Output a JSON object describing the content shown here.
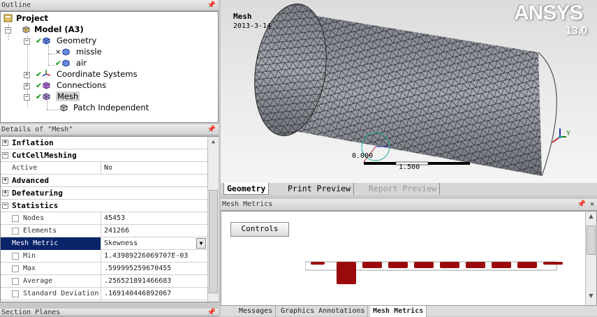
{
  "outline": {
    "title": "Outline",
    "tree": [
      {
        "label": "Project"
      },
      {
        "label": "Model (A3)"
      },
      {
        "label": "Geometry"
      },
      {
        "label": "missle"
      },
      {
        "label": "air"
      },
      {
        "label": "Coordinate Systems"
      },
      {
        "label": "Connections"
      },
      {
        "label": "Mesh"
      },
      {
        "label": "Patch Independent"
      }
    ]
  },
  "details": {
    "title": "Details of \"Mesh\"",
    "groups": {
      "inflation": "Inflation",
      "cutcell": "CutCellMeshing",
      "advanced": "Advanced",
      "defeaturing": "Defeaturing",
      "statistics": "Statistics"
    },
    "props": {
      "active": {
        "key": "Active",
        "value": "No"
      },
      "nodes": {
        "key": "Nodes",
        "value": "45453"
      },
      "elements": {
        "key": "Elements",
        "value": "241266"
      },
      "metric": {
        "key": "Mesh Metric",
        "value": "Skewness"
      },
      "min": {
        "key": "Min",
        "value": "1.43989226069707E-03"
      },
      "max": {
        "key": "Max",
        "value": ".599995259670455"
      },
      "average": {
        "key": "Average",
        "value": ".256521891466683"
      },
      "stddev": {
        "key": "Standard Deviation",
        "value": ".169140446892067"
      }
    }
  },
  "section_planes": {
    "title": "Section Planes"
  },
  "viewport": {
    "label": "Mesh",
    "date": "2013-3-14",
    "logo": "ANSYS",
    "version": "13.0",
    "scale_left": "0.000",
    "scale_mid": "1.500",
    "axis_y": "Y",
    "tabs": [
      "Geometry",
      "Print Preview",
      "Report Preview"
    ]
  },
  "mesh_metrics": {
    "title": "Mesh Metrics",
    "controls_label": "Controls",
    "histogram": [
      0.12,
      1.0,
      0.28,
      0.28,
      0.28,
      0.28,
      0.28,
      0.28,
      0.28,
      0.12
    ],
    "bar_color": "#9a0a0a"
  },
  "bottom_tabs": [
    "Messages",
    "Graphics Annotations",
    "Mesh Metrics"
  ],
  "colors": {
    "accent": "#0a246a",
    "check": "#0a9a0a",
    "mesh_fill": "#8d9099"
  }
}
